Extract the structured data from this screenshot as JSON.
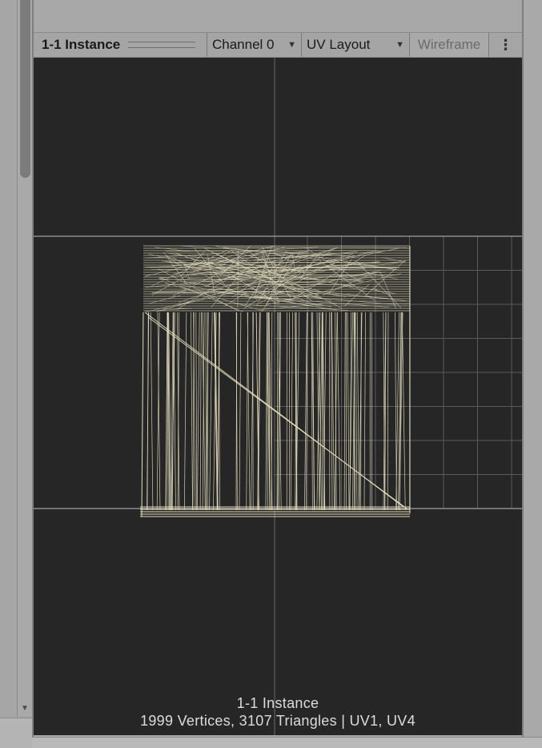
{
  "toolbar": {
    "title": "1-1 Instance",
    "channel_label": "Channel 0",
    "uv_layout_label": "UV Layout",
    "wireframe_label": "Wireframe",
    "more_label": "⋮"
  },
  "preview": {
    "caption_title": "1-1 Instance",
    "caption_stats": "1999 Vertices, 3107 Triangles | UV1, UV4"
  },
  "colors": {
    "viewport_bg": "#262626",
    "wire": "#e6dfbf",
    "grid": "#5a5a5a",
    "axis": "#bdbdbd"
  },
  "icons": {
    "dropdown": "triangle-down-icon",
    "more": "vertical-ellipsis-icon",
    "scroll_down": "scroll-down-arrow-icon",
    "drag": "drag-handle-icon"
  }
}
